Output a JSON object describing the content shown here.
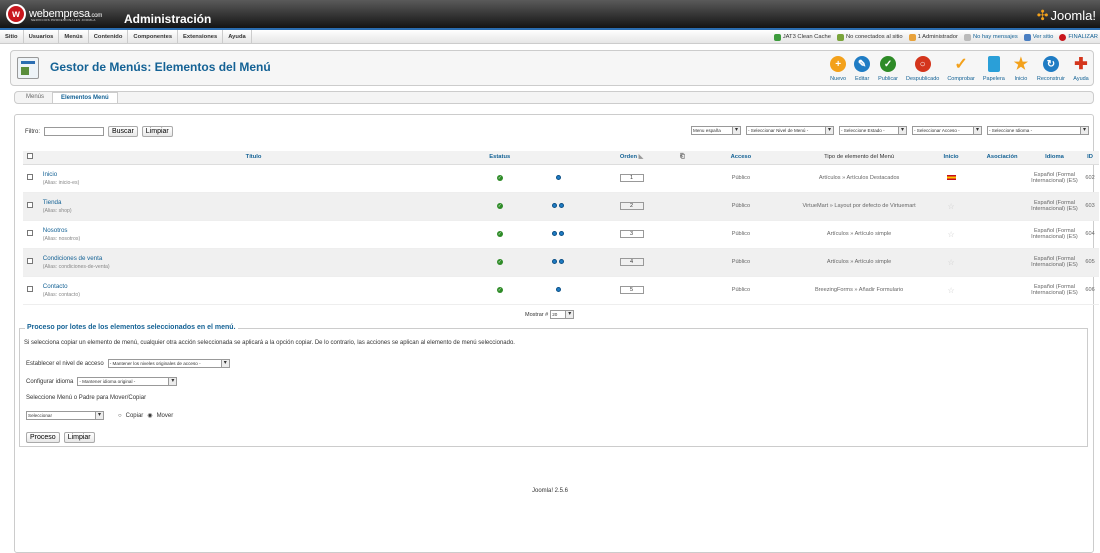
{
  "header": {
    "brand": "webempresa",
    "brand_suffix": ".com",
    "tagline": "SERVICIOS PROFESIONALES JOOMLA",
    "admin_title": "Administración",
    "joomla_logo": "Joomla!"
  },
  "menubar": [
    "Sitio",
    "Usuarios",
    "Menús",
    "Contenido",
    "Componentes",
    "Extensiones",
    "Ayuda"
  ],
  "status": {
    "clean": "JAT3 Clean Cache",
    "online": "No conectados al sitio",
    "admins": "1 Administrador",
    "messages": "No hay mensajes",
    "view": "Ver sitio",
    "logout": "FINALIZAR"
  },
  "toolbar": {
    "title": "Gestor de Menús: Elementos del Menú",
    "buttons": [
      {
        "label": "Nuevo",
        "color": "#f3a11b",
        "glyph": "+"
      },
      {
        "label": "Editar",
        "color": "#1f7cc4",
        "glyph": "✎"
      },
      {
        "label": "Publicar",
        "color": "#2e8b27",
        "glyph": "✓"
      },
      {
        "label": "Despublicado",
        "color": "#d4351c",
        "glyph": "○"
      },
      {
        "label": "Comprobar",
        "color": "#f3a11b",
        "glyph": "✓"
      },
      {
        "label": "Papelera",
        "color": "#2a9fd8",
        "glyph": "▮"
      },
      {
        "label": "Inicio",
        "color": "#f3a11b",
        "glyph": "★"
      },
      {
        "label": "Reconstruir",
        "color": "#1f7cc4",
        "glyph": "↻"
      },
      {
        "label": "Ayuda",
        "color": "#d4351c",
        "glyph": "✚"
      }
    ]
  },
  "tabs": [
    "Menús",
    "Elementos Menú"
  ],
  "filter": {
    "label": "Filtro:",
    "search": "Buscar",
    "clear": "Limpiar"
  },
  "selects": [
    "Menu españa",
    "- Seleccionar Nivel de Menú -",
    "- Seleccione Estado -",
    "- Seleccionar Acceso -",
    "- Seleccione Idioma -"
  ],
  "columns": {
    "title": "Título",
    "status": "Estatus",
    "order": "Orden",
    "access": "Acceso",
    "type": "Tipo de elemento del Menú",
    "home": "Inicio",
    "assoc": "Asociación",
    "lang": "Idioma",
    "id": "ID"
  },
  "rows": [
    {
      "title": "Inicio",
      "alias": "(Alias: inicio-es)",
      "order": "1",
      "access": "Público",
      "type": "Artículos » Artículos Destacados",
      "lang": "Español (Formal Internacional) (ES)",
      "id": "602"
    },
    {
      "title": "Tienda",
      "alias": "(Alias: shop)",
      "order": "2",
      "access": "Público",
      "type": "VirtueMart » Layout por defecto de Virtuemart",
      "lang": "Español (Formal Internacional) (ES)",
      "id": "603"
    },
    {
      "title": "Nosotros",
      "alias": "(Alias: nosotros)",
      "order": "3",
      "access": "Público",
      "type": "Artículos » Artículo simple",
      "lang": "Español (Formal Internacional) (ES)",
      "id": "604"
    },
    {
      "title": "Condiciones de venta",
      "alias": "(Alias: condiciones-de-venta)",
      "order": "4",
      "access": "Público",
      "type": "Artículos » Artículo simple",
      "lang": "Español (Formal Internacional) (ES)",
      "id": "605"
    },
    {
      "title": "Contacto",
      "alias": "(Alias: contacto)",
      "order": "5",
      "access": "Público",
      "type": "BreezingForms » Añadir Formulario",
      "lang": "Español (Formal Internacional) (ES)",
      "id": "606"
    }
  ],
  "pager": {
    "label": "Mostrar #",
    "value": "20"
  },
  "batch": {
    "legend": "Proceso por lotes de los elementos seleccionados en el menú.",
    "note": "Si selecciona copiar un elemento de menú, cualquier otra acción seleccionada se aplicará a la opción copiar. De lo contrario, las acciones se aplican al elemento de menú seleccionado.",
    "access_label": "Establecer el nivel de acceso",
    "access_value": "- Mantener los niveles originales de acceso -",
    "lang_label": "Configurar idioma",
    "lang_value": "- Mantener idioma original -",
    "move_label": "Seleccione Menú o Padre para Mover/Copiar",
    "move_value": "Seleccionar",
    "copy": "Copiar",
    "move": "Mover",
    "process": "Proceso",
    "clear": "Limpiar"
  },
  "footer": "Joomla! 2.5.6"
}
